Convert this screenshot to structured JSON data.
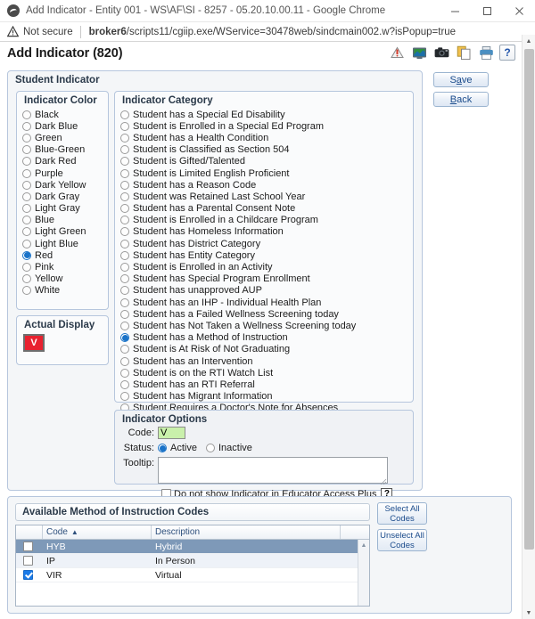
{
  "browser": {
    "window_title": "Add Indicator - Entity 001 - WS\\AF\\SI - 8257 - 05.20.10.00.11 - Google Chrome",
    "security_label": "Not secure",
    "url_host": "broker6",
    "url_path": "/scripts11/cgiip.exe/WService=30478web/sindcmain002.w?isPopup=true",
    "minimize_label": "Minimize",
    "maximize_label": "Maximize",
    "close_label": "Close"
  },
  "header": {
    "title": "Add Indicator (820)",
    "help_label": "?",
    "icons": [
      "alert-icon",
      "monitor-icon",
      "camera-icon",
      "copy-icon",
      "print-icon"
    ]
  },
  "actions": {
    "save_label_prefix": "S",
    "save_label_accel": "a",
    "save_label_suffix": "ve",
    "back_label_prefix": "",
    "back_label_accel": "B",
    "back_label_suffix": "ack"
  },
  "student_indicator": {
    "title": "Student Indicator"
  },
  "indicator_color": {
    "title": "Indicator Color",
    "selected": "Red",
    "options": [
      "Black",
      "Dark Blue",
      "Green",
      "Blue-Green",
      "Dark Red",
      "Purple",
      "Dark Yellow",
      "Dark Gray",
      "Light Gray",
      "Blue",
      "Light Green",
      "Light Blue",
      "Red",
      "Pink",
      "Yellow",
      "White"
    ]
  },
  "actual_display": {
    "title": "Actual Display",
    "swatch_text": "V",
    "swatch_color": "#e8212f",
    "swatch_text_color": "#ffffff"
  },
  "indicator_category": {
    "title": "Indicator Category",
    "selected": "Student has a Method of Instruction",
    "options": [
      "Student has a Special Ed Disability",
      "Student is Enrolled in a Special Ed Program",
      "Student has a Health Condition",
      "Student is Classified as Section 504",
      "Student is Gifted/Talented",
      "Student is Limited English Proficient",
      "Student has a Reason Code",
      "Student was Retained Last School Year",
      "Student has a Parental Consent Note",
      "Student is Enrolled in a Childcare Program",
      "Student has Homeless Information",
      "Student has District Category",
      "Student has Entity Category",
      "Student is Enrolled in an Activity",
      "Student has Special Program Enrollment",
      "Student has unapproved AUP",
      "Student has an IHP - Individual Health Plan",
      "Student has a Failed Wellness Screening today",
      "Student has Not Taken a Wellness Screening today",
      "Student has a Method of Instruction",
      "Student is At Risk of Not Graduating",
      "Student has an Intervention",
      "Student is on the RTI Watch List",
      "Student has an RTI Referral",
      "Student has Migrant Information",
      "Student Requires a Doctor's Note for Absences"
    ]
  },
  "indicator_options": {
    "title": "Indicator Options",
    "code_label": "Code:",
    "code_value": "V",
    "code_bg": "#c9f0ab",
    "status_label": "Status:",
    "status_active_label": "Active",
    "status_inactive_label": "Inactive",
    "status_selected": "Active",
    "tooltip_label": "Tooltip:",
    "tooltip_value": "",
    "hide_checkbox_label": "Do not show Indicator in Educator Access Plus",
    "hide_checkbox_checked": false,
    "hide_help_label": "?"
  },
  "codes_panel": {
    "title": "Available Method of Instruction Codes",
    "select_all_label": "Select All Codes",
    "unselect_all_label": "Unselect All Codes",
    "columns": [
      "",
      "Code",
      "Description",
      ""
    ],
    "sort_column": "Code",
    "sort_direction": "asc",
    "rows": [
      {
        "checked": false,
        "code": "HYB",
        "description": "Hybrid",
        "selected": true
      },
      {
        "checked": false,
        "code": "IP",
        "description": "In Person",
        "selected": false
      },
      {
        "checked": true,
        "code": "VIR",
        "description": "Virtual",
        "selected": false
      }
    ]
  }
}
